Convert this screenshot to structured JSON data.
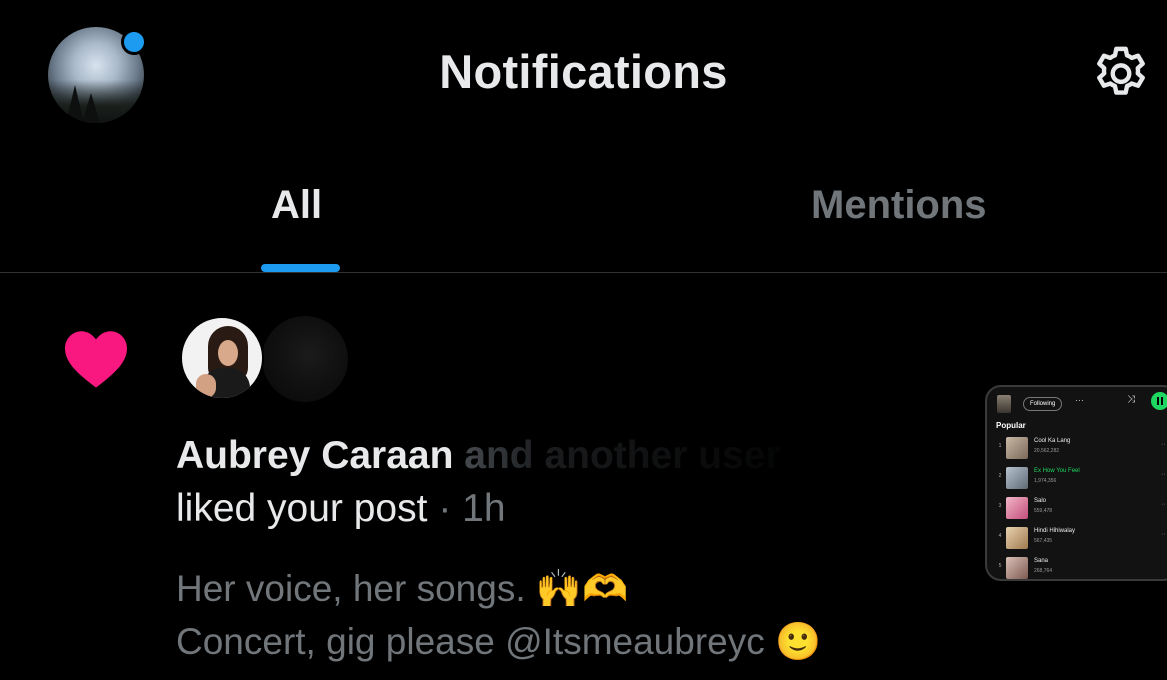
{
  "header": {
    "title": "Notifications",
    "settings_icon": "gear-icon"
  },
  "tabs": [
    {
      "label": "All",
      "selected": true
    },
    {
      "label": "Mentions",
      "selected": false
    }
  ],
  "colors": {
    "accent": "#1d9bf0",
    "like": "#f91880",
    "background": "#000000",
    "muted_text": "#71767b"
  },
  "notification": {
    "icon": "heart-icon",
    "actor_name": "Aubrey Caraan",
    "actor_name_faded": "and another user",
    "action": "liked your post",
    "separator": "·",
    "time": "1h",
    "post_line1": "Her voice, her songs. 🙌🫶",
    "post_line2": "Concert, gig please @Itsmeaubreyc 🙂"
  },
  "pip_preview": {
    "follow_label": "Following",
    "more_label": "···",
    "section_title": "Popular",
    "tracks": [
      {
        "rank": "1",
        "title": "Cool Ka Lang",
        "plays": "20,562,282",
        "active": false
      },
      {
        "rank": "2",
        "title": "Ex How You Feel",
        "plays": "1,974,356",
        "active": true
      },
      {
        "rank": "3",
        "title": "Salo",
        "plays": "559,478",
        "active": false
      },
      {
        "rank": "4",
        "title": "Hindi Hihiwalay",
        "plays": "567,435",
        "active": false
      },
      {
        "rank": "5",
        "title": "Sana",
        "plays": "268,764",
        "active": false
      }
    ]
  }
}
